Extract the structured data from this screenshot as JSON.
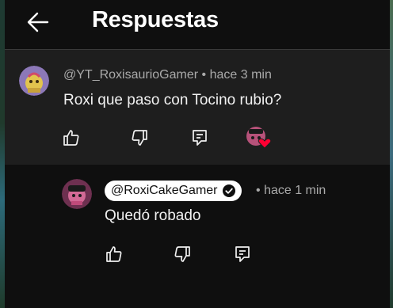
{
  "header": {
    "title": "Respuestas",
    "back_icon": "arrow-left-icon"
  },
  "parent_comment": {
    "author": "@YT_RoxisaurioGamer",
    "separator": "•",
    "time": "hace 3 min",
    "text": "Roxi que paso con Tocino rubio?",
    "actions": [
      "like-icon",
      "dislike-icon",
      "reply-icon",
      "creator-heart-icon"
    ]
  },
  "reply_comment": {
    "author": "@RoxiCakeGamer",
    "verified_icon": "verified-check-icon",
    "separator": "•",
    "time": "hace 1 min",
    "text": "Quedó robado",
    "actions": [
      "like-icon",
      "dislike-icon",
      "reply-icon"
    ]
  },
  "colors": {
    "background": "#0f0f0f",
    "parent_background": "#1e1e1e",
    "secondary_text": "#aaaaaa",
    "heart": "#ff0033"
  }
}
